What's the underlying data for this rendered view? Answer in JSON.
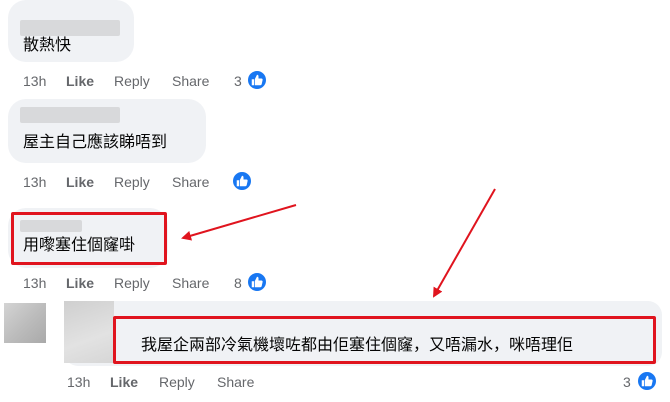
{
  "comments": [
    {
      "text": "散熱快",
      "actions": {
        "time": "13h",
        "like": "Like",
        "reply": "Reply",
        "share": "Share"
      },
      "reaction_count": "3",
      "reaction_icon": "thumbs-up-icon"
    },
    {
      "text": "屋主自己應該睇唔到",
      "actions": {
        "time": "13h",
        "like": "Like",
        "reply": "Reply",
        "share": "Share"
      },
      "reaction_count": "",
      "reaction_icon": "thumbs-up-icon"
    },
    {
      "text": "用嚟塞住個窿啩",
      "actions": {
        "time": "13h",
        "like": "Like",
        "reply": "Reply",
        "share": "Share"
      },
      "reaction_count": "8",
      "reaction_icon": "thumbs-up-icon"
    },
    {
      "text": "我屋企兩部冷氣機壞咗都由佢塞住個窿，又唔漏水，咪唔理佢",
      "actions": {
        "time": "13h",
        "like": "Like",
        "reply": "Reply",
        "share": "Share"
      },
      "reaction_count": "3",
      "reaction_icon": "thumbs-up-icon"
    }
  ],
  "colors": {
    "bubble": "#f0f2f5",
    "action_text": "#65676b",
    "like_blue": "#1877f2",
    "highlight_red": "#e0141e"
  }
}
